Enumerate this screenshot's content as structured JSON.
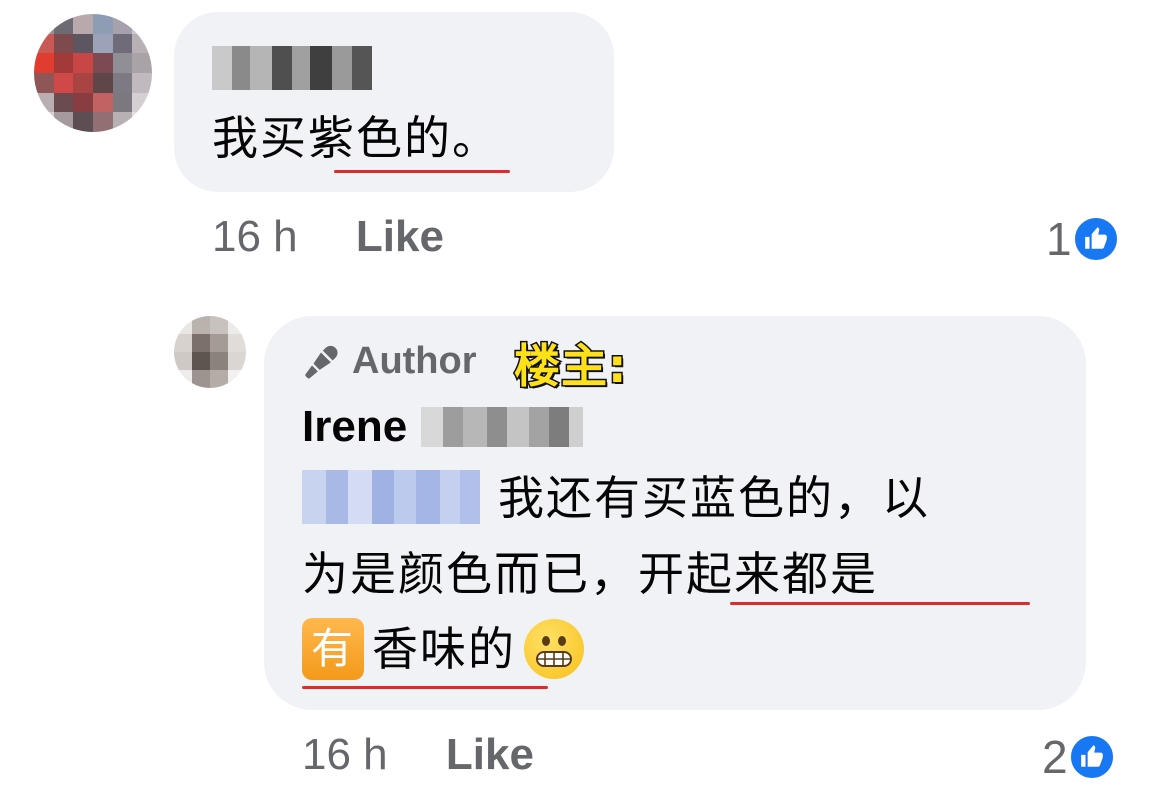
{
  "comment1": {
    "author_name_hidden": true,
    "text_a": "我买",
    "text_b": "紫色的",
    "text_c": "。",
    "time": "16 h",
    "like_label": "Like",
    "reaction_count": "1"
  },
  "comment2": {
    "author_badge": "Author",
    "annotation": "楼主:",
    "author_name": "Irene",
    "line1": "我还有买蓝色的，以",
    "line2_a": "为是颜色而已，",
    "line2_b": "开起来都是",
    "line3_emoji": "有",
    "line3_text": "香味的",
    "time": "16 h",
    "like_label": "Like",
    "reaction_count": "2"
  },
  "colors": {
    "bubble": "#f0f2f5",
    "meta_text": "#65676b",
    "like_blue": "#1877f2",
    "underline_red": "#e02b2b",
    "annotation_yellow": "#ffe11a"
  },
  "icons": {
    "author_badge": "microphone-icon",
    "reaction": "thumbs-up-icon",
    "emoji_grimace": "grimacing-face-emoji",
    "emoji_you": "japanese-have-button-emoji"
  }
}
